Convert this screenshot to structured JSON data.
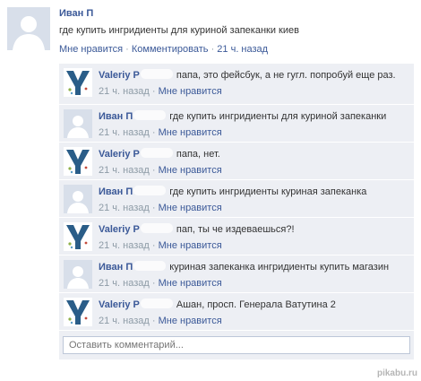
{
  "post": {
    "author": "Иван П",
    "text": "где купить ингридиенты для куриной запеканки киев",
    "like": "Мне нравится",
    "comment": "Комментировать",
    "time": "21 ч. назад",
    "separator": " · "
  },
  "comments": [
    {
      "author": "Valeriy P",
      "text": "папа, это фейсбук, а не гугл. попробуй еще раз.",
      "time": "21 ч. назад",
      "like": "Мне нравится",
      "avatar": "v-logo-icon"
    },
    {
      "author": "Иван П",
      "text": "где купить ингридиенты для куриной запеканки",
      "time": "21 ч. назад",
      "like": "Мне нравится",
      "avatar": "silhouette-avatar-icon"
    },
    {
      "author": "Valeriy P",
      "text": "папа, нет.",
      "time": "21 ч. назад",
      "like": "Мне нравится",
      "avatar": "v-logo-icon"
    },
    {
      "author": "Иван П",
      "text": "где купить ингридиенты куриная запеканка",
      "time": "21 ч. назад",
      "like": "Мне нравится",
      "avatar": "silhouette-avatar-icon"
    },
    {
      "author": "Valeriy P",
      "text": "пап, ты че издеваешься?!",
      "time": "21 ч. назад",
      "like": "Мне нравится",
      "avatar": "v-logo-icon"
    },
    {
      "author": "Иван П",
      "text": "куриная запеканка ингридиенты купить магазин",
      "time": "21 ч. назад",
      "like": "Мне нравится",
      "avatar": "silhouette-avatar-icon"
    },
    {
      "author": "Valeriy P",
      "text": "Ашан,  просп. Генерала Ватутина 2",
      "time": "21 ч. назад",
      "like": "Мне нравится",
      "avatar": "v-logo-icon"
    }
  ],
  "comment_box": {
    "placeholder": "Оставить комментарий..."
  },
  "watermark": "pikabu.ru",
  "colors": {
    "link": "#3b5998",
    "meta": "#8d9ba6",
    "comment_bg": "#edeff4",
    "avatar_bg": "#d8dfea"
  }
}
